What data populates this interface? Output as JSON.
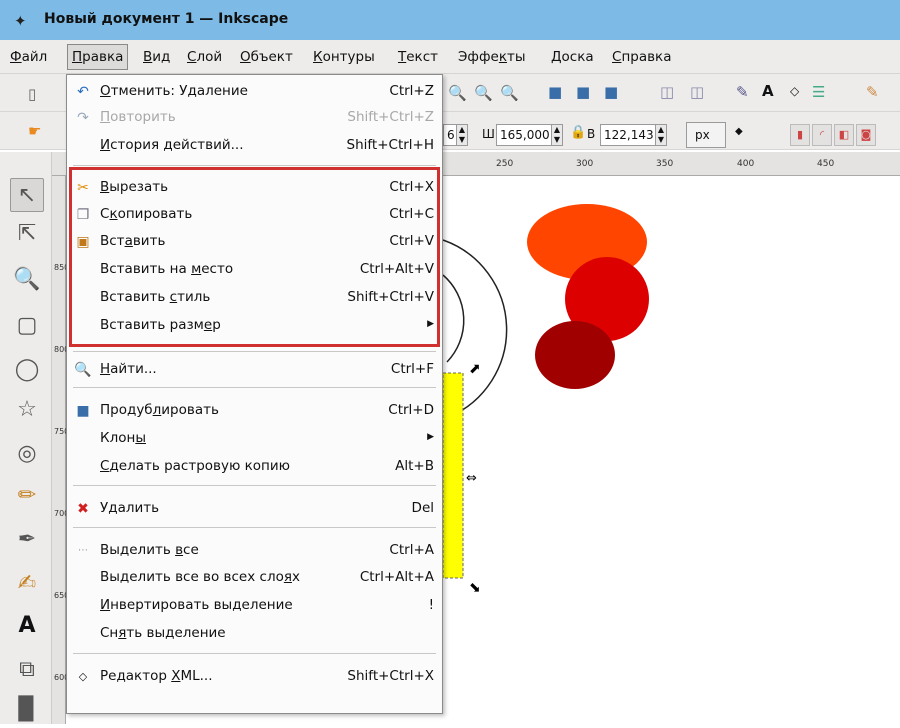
{
  "window": {
    "title": "Новый документ 1 — Inkscape",
    "icon": "inkscape-logo-icon"
  },
  "menubar": {
    "items": [
      {
        "label": "Файл",
        "u": "Ф",
        "rest": "айл"
      },
      {
        "label": "Правка",
        "u": "П",
        "rest": "равка"
      },
      {
        "label": "Вид",
        "u": "В",
        "rest": "ид"
      },
      {
        "label": "Слой",
        "u": "С",
        "rest": "лой"
      },
      {
        "label": "Объект",
        "u": "О",
        "rest": "бъект"
      },
      {
        "label": "Контуры",
        "u": "К",
        "rest": "онтуры"
      },
      {
        "label": "Текст",
        "u": "Т",
        "rest": "екст"
      },
      {
        "label": "Эффекты",
        "pre": "Эффе",
        "u": "к",
        "rest": "ты"
      },
      {
        "label": "Доска",
        "u": "Д",
        "rest": "оска"
      },
      {
        "label": "Справка",
        "u": "С",
        "rest": "правка"
      }
    ]
  },
  "toolbar2": {
    "w_label": "Ш",
    "w_value": "165,000",
    "h_label": "В",
    "h_value": "122,143",
    "x_value": "6",
    "unit": "px"
  },
  "ruler": {
    "ticks": [
      "250",
      "300",
      "350",
      "400",
      "450"
    ]
  },
  "vruler": {
    "labels": [
      "850",
      "800",
      "750",
      "700",
      "650",
      "600"
    ]
  },
  "edit_menu": {
    "items": [
      {
        "pre": "",
        "u": "О",
        "rest": "тменить: Удаление",
        "accel": "Ctrl+Z",
        "icon": "undo-icon",
        "disabled": false
      },
      {
        "pre": "",
        "u": "П",
        "rest": "овторить",
        "accel": "Shift+Ctrl+Z",
        "icon": "redo-icon",
        "disabled": true
      },
      {
        "pre": "",
        "u": "И",
        "rest": "стория действий...",
        "accel": "Shift+Ctrl+H",
        "icon": "",
        "disabled": false
      },
      {
        "pre": "",
        "u": "В",
        "rest": "ырезать",
        "accel": "Ctrl+X",
        "icon": "cut-icon",
        "disabled": false
      },
      {
        "pre": "С",
        "u": "к",
        "rest": "опировать",
        "accel": "Ctrl+C",
        "icon": "copy-icon",
        "disabled": false
      },
      {
        "pre": "Вст",
        "u": "а",
        "rest": "вить",
        "accel": "Ctrl+V",
        "icon": "paste-icon",
        "disabled": false
      },
      {
        "pre": "Вставить на ",
        "u": "м",
        "rest": "есто",
        "accel": "Ctrl+Alt+V",
        "icon": "",
        "disabled": false
      },
      {
        "pre": "Вставить ",
        "u": "с",
        "rest": "тиль",
        "accel": "Shift+Ctrl+V",
        "icon": "",
        "disabled": false
      },
      {
        "pre": "Вставить разм",
        "u": "е",
        "rest": "р",
        "accel": "",
        "icon": "",
        "disabled": false,
        "submenu": true
      },
      {
        "pre": "",
        "u": "Н",
        "rest": "айти...",
        "accel": "Ctrl+F",
        "icon": "find-icon",
        "disabled": false
      },
      {
        "pre": "Продуб",
        "u": "л",
        "rest": "ировать",
        "accel": "Ctrl+D",
        "icon": "duplicate-icon",
        "disabled": false
      },
      {
        "pre": "Клон",
        "u": "ы",
        "rest": "",
        "accel": "",
        "icon": "",
        "disabled": false,
        "submenu": true
      },
      {
        "pre": "",
        "u": "С",
        "rest": "делать растровую копию",
        "accel": "Alt+B",
        "icon": "",
        "disabled": false
      },
      {
        "pre": "У",
        "u": "д",
        "rest": "алить",
        "accel": "Del",
        "icon": "delete-icon",
        "disabled": false
      },
      {
        "pre": "Выделить ",
        "u": "в",
        "rest": "се",
        "accel": "Ctrl+A",
        "icon": "select-all-icon",
        "disabled": false
      },
      {
        "pre": "Выделить все во всех сло",
        "u": "я",
        "rest": "х",
        "accel": "Ctrl+Alt+A",
        "icon": "",
        "disabled": false
      },
      {
        "pre": "",
        "u": "И",
        "rest": "нвертировать выделение",
        "accel": "!",
        "icon": "",
        "disabled": false
      },
      {
        "pre": "Сн",
        "u": "я",
        "rest": "ть выделение",
        "accel": "",
        "icon": "",
        "disabled": false
      },
      {
        "pre": "Редактор ",
        "u": "X",
        "rest": "ML...",
        "accel": "Shift+Ctrl+X",
        "icon": "xml-editor-icon",
        "disabled": false
      }
    ]
  },
  "colors": {
    "circle1": "#ff4500",
    "circle2": "#dd0000",
    "circle3": "#a00000",
    "rect": "#ffff00",
    "highlight": "#d03030",
    "titlebar": "#7dbbe6"
  }
}
